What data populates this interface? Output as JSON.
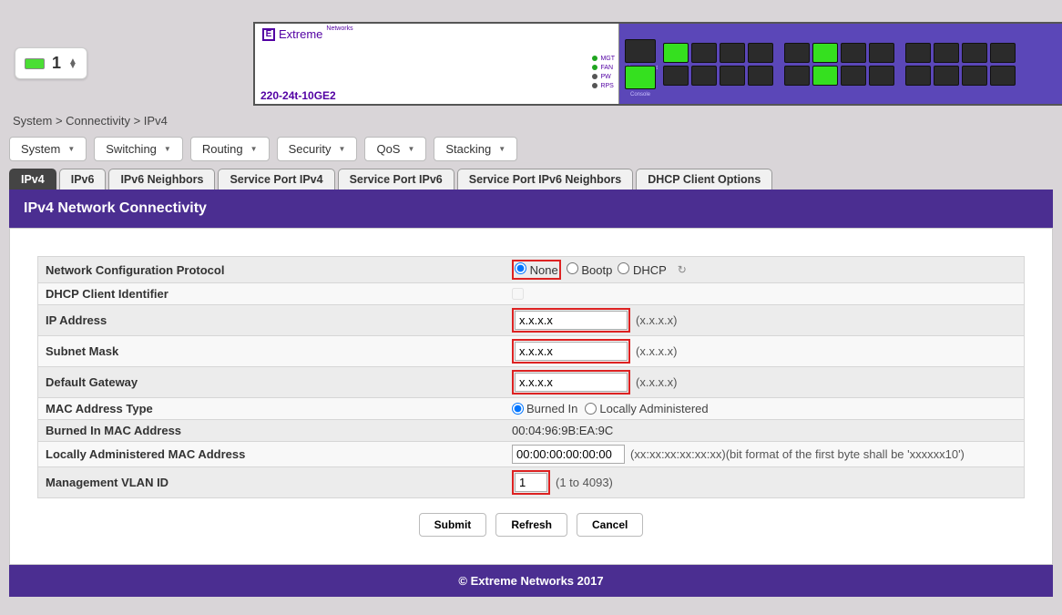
{
  "device_selector": {
    "value": "1"
  },
  "switch": {
    "brand": "Extreme",
    "brand_sub": "Networks",
    "model": "220-24t-10GE2",
    "leds": [
      "MGT",
      "FAN",
      "PW",
      "RPS"
    ],
    "mgmt_ports": [
      "Management",
      "Console"
    ]
  },
  "breadcrumb": "System > Connectivity > IPv4",
  "menus": [
    "System",
    "Switching",
    "Routing",
    "Security",
    "QoS",
    "Stacking"
  ],
  "subtabs": [
    "IPv4",
    "IPv6",
    "IPv6 Neighbors",
    "Service Port IPv4",
    "Service Port IPv6",
    "Service Port IPv6 Neighbors",
    "DHCP Client Options"
  ],
  "active_subtab": "IPv4",
  "page_title": "IPv4 Network Connectivity",
  "fields": {
    "ncp_label": "Network Configuration Protocol",
    "ncp_options": [
      "None",
      "Bootp",
      "DHCP"
    ],
    "ncp_selected": "None",
    "dhcp_id_label": "DHCP Client Identifier",
    "ip_label": "IP Address",
    "ip_value": "x.x.x.x",
    "ip_hint": "(x.x.x.x)",
    "mask_label": "Subnet Mask",
    "mask_value": "x.x.x.x",
    "mask_hint": "(x.x.x.x)",
    "gw_label": "Default Gateway",
    "gw_value": "x.x.x.x",
    "gw_hint": "(x.x.x.x)",
    "mac_type_label": "MAC Address Type",
    "mac_type_options": [
      "Burned In",
      "Locally Administered"
    ],
    "mac_type_selected": "Burned In",
    "burned_mac_label": "Burned In MAC Address",
    "burned_mac_value": "00:04:96:9B:EA:9C",
    "local_mac_label": "Locally Administered MAC Address",
    "local_mac_value": "00:00:00:00:00:00",
    "local_mac_hint": "(xx:xx:xx:xx:xx:xx)(bit format of the first byte shall be 'xxxxxx10')",
    "vlan_label": "Management VLAN ID",
    "vlan_value": "1",
    "vlan_hint": "(1 to 4093)"
  },
  "buttons": {
    "submit": "Submit",
    "refresh": "Refresh",
    "cancel": "Cancel"
  },
  "footer": "© Extreme Networks 2017"
}
